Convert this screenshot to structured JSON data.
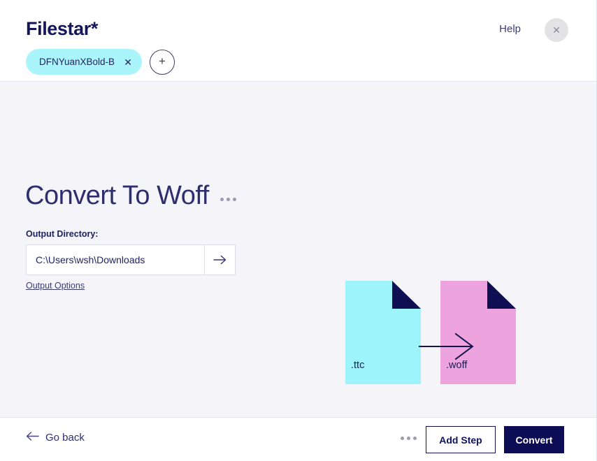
{
  "header": {
    "brand": "Filestar*",
    "help_label": "Help",
    "close_icon": "close-icon",
    "tabs": [
      {
        "label": "DFNYuanXBold-B…",
        "close_icon": "close-icon"
      }
    ],
    "add_tab_label": "+"
  },
  "main": {
    "page_title": "Convert To Woff",
    "title_menu_icon": "ellipsis-icon",
    "output_directory_label": "Output Directory:",
    "output_directory_value": "C:\\Users\\wsh\\Downloads",
    "output_directory_placeholder": "Output Directory",
    "browse_icon": "arrow-right-icon",
    "output_options_label": "Output Options"
  },
  "graphic": {
    "source_ext": ".ttc",
    "target_ext": ".woff",
    "arrow_icon": "arrow-right-icon",
    "source_color": "#9df4fb",
    "target_color": "#eda3dd",
    "fold_color": "#0e1053",
    "arrow_color": "#14144f"
  },
  "footer": {
    "go_back_label": "Go back",
    "go_back_icon": "arrow-left-icon",
    "more_icon": "ellipsis-icon",
    "add_step_label": "Add Step",
    "convert_label": "Convert"
  },
  "colors": {
    "brand_navy": "#15155a",
    "accent_cyan": "#aaf5fb",
    "accent_pink": "#eda3dd",
    "primary_button": "#0d0d56",
    "body_background": "#f4f4f9",
    "panel_background": "#ffffff"
  }
}
